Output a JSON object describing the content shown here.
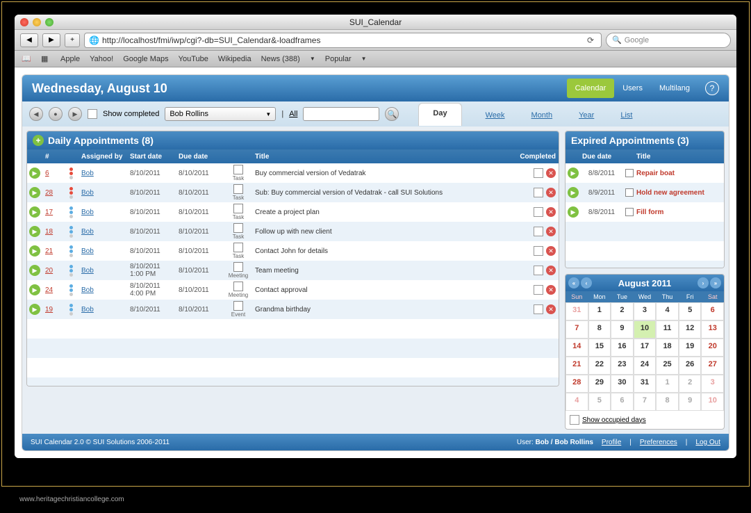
{
  "window": {
    "title": "SUI_Calendar"
  },
  "url": "http://localhost/fmi/iwp/cgi?-db=SUI_Calendar&-loadframes",
  "search_placeholder": "Google",
  "bookmarks": [
    "Apple",
    "Yahoo!",
    "Google Maps",
    "YouTube",
    "Wikipedia",
    "News (388)",
    "Popular"
  ],
  "app": {
    "title": "Wednesday, August 10",
    "tabs": {
      "calendar": "Calendar",
      "users": "Users",
      "multilang": "Multilang"
    },
    "filter": {
      "show_completed": "Show completed",
      "user": "Bob Rollins",
      "all": "All"
    },
    "views": {
      "day": "Day",
      "week": "Week",
      "month": "Month",
      "year": "Year",
      "list": "List"
    }
  },
  "daily": {
    "title": "Daily Appointments (8)",
    "headers": {
      "num": "#",
      "assigned": "Assigned by",
      "start": "Start date",
      "due": "Due date",
      "title": "Title",
      "completed": "Completed"
    },
    "rows": [
      {
        "num": "6",
        "assn": "Bob",
        "start": "8/10/2011",
        "due": "8/10/2011",
        "type": "Task",
        "title": "Buy commercial version of Vedatrak",
        "pri": "high"
      },
      {
        "num": "28",
        "assn": "Bob",
        "start": "8/10/2011",
        "due": "8/10/2011",
        "type": "Task",
        "title": "Sub: Buy commercial version of Vedatrak - call SUI Solutions",
        "pri": "high"
      },
      {
        "num": "17",
        "assn": "Bob",
        "start": "8/10/2011",
        "due": "8/10/2011",
        "type": "Task",
        "title": "Create a project plan",
        "pri": "low"
      },
      {
        "num": "18",
        "assn": "Bob",
        "start": "8/10/2011",
        "due": "8/10/2011",
        "type": "Task",
        "title": "Follow up with new client",
        "pri": "low"
      },
      {
        "num": "21",
        "assn": "Bob",
        "start": "8/10/2011",
        "due": "8/10/2011",
        "type": "Task",
        "title": "Contact John for details",
        "pri": "low"
      },
      {
        "num": "20",
        "assn": "Bob",
        "start": "8/10/2011",
        "start2": "1:00 PM",
        "due": "8/10/2011",
        "type": "Meeting",
        "title": "Team meeting",
        "pri": "low"
      },
      {
        "num": "24",
        "assn": "Bob",
        "start": "8/10/2011",
        "start2": "4:00 PM",
        "due": "8/10/2011",
        "type": "Meeting",
        "title": "Contact approval",
        "pri": "low"
      },
      {
        "num": "19",
        "assn": "Bob",
        "start": "8/10/2011",
        "due": "8/10/2011",
        "type": "Event",
        "title": "Grandma birthday",
        "pri": "low"
      }
    ]
  },
  "expired": {
    "title": "Expired Appointments (3)",
    "headers": {
      "due": "Due date",
      "title": "Title"
    },
    "rows": [
      {
        "due": "8/8/2011",
        "title": "Repair boat"
      },
      {
        "due": "8/9/2011",
        "title": "Hold new agreement"
      },
      {
        "due": "8/8/2011",
        "title": "Fill form"
      }
    ]
  },
  "minical": {
    "title": "August 2011",
    "days": [
      "Sun",
      "Mon",
      "Tue",
      "Wed",
      "Thu",
      "Fri",
      "Sat"
    ],
    "cells": [
      {
        "d": "31",
        "cls": "other sun"
      },
      {
        "d": "1"
      },
      {
        "d": "2"
      },
      {
        "d": "3"
      },
      {
        "d": "4"
      },
      {
        "d": "5"
      },
      {
        "d": "6",
        "cls": "sat"
      },
      {
        "d": "7",
        "cls": "sun"
      },
      {
        "d": "8"
      },
      {
        "d": "9"
      },
      {
        "d": "10",
        "cls": "today"
      },
      {
        "d": "11"
      },
      {
        "d": "12"
      },
      {
        "d": "13",
        "cls": "sat"
      },
      {
        "d": "14",
        "cls": "sun"
      },
      {
        "d": "15"
      },
      {
        "d": "16"
      },
      {
        "d": "17"
      },
      {
        "d": "18"
      },
      {
        "d": "19"
      },
      {
        "d": "20",
        "cls": "sat"
      },
      {
        "d": "21",
        "cls": "sun"
      },
      {
        "d": "22"
      },
      {
        "d": "23"
      },
      {
        "d": "24"
      },
      {
        "d": "25"
      },
      {
        "d": "26"
      },
      {
        "d": "27",
        "cls": "sat"
      },
      {
        "d": "28",
        "cls": "sun"
      },
      {
        "d": "29"
      },
      {
        "d": "30"
      },
      {
        "d": "31"
      },
      {
        "d": "1",
        "cls": "other"
      },
      {
        "d": "2",
        "cls": "other"
      },
      {
        "d": "3",
        "cls": "other sat"
      },
      {
        "d": "4",
        "cls": "other sun"
      },
      {
        "d": "5",
        "cls": "other"
      },
      {
        "d": "6",
        "cls": "other"
      },
      {
        "d": "7",
        "cls": "other"
      },
      {
        "d": "8",
        "cls": "other"
      },
      {
        "d": "9",
        "cls": "other"
      },
      {
        "d": "10",
        "cls": "other sat"
      }
    ],
    "show_occupied": "Show occupied days"
  },
  "footer": {
    "copyright": "SUI Calendar 2.0 © SUI Solutions 2006-2011",
    "user_label": "User:",
    "user": "Bob / Bob Rollins",
    "profile": "Profile",
    "preferences": "Preferences",
    "logout": "Log Out"
  },
  "watermark": "www.heritagechristiancollege.com"
}
